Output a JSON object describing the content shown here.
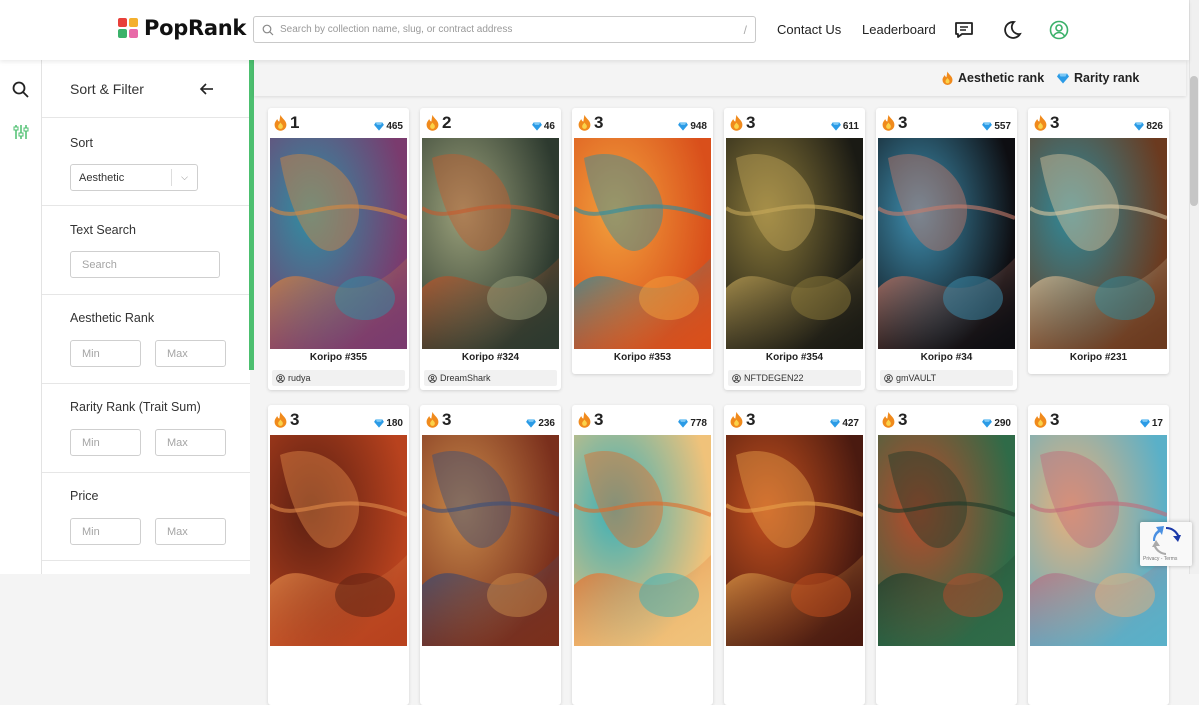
{
  "header": {
    "brand": "PopRank",
    "search_placeholder": "Search by collection name, slug, or contract address",
    "search_hint": "/",
    "contact_label": "Contact Us",
    "leaderboard_label": "Leaderboard",
    "icons": [
      "chat-icon",
      "moon-icon",
      "user-icon"
    ]
  },
  "rail": {
    "icons": [
      "search-icon",
      "sliders-icon"
    ]
  },
  "filters": {
    "title": "Sort & Filter",
    "sort_label": "Sort",
    "sort_value": "Aesthetic",
    "text_search_label": "Text Search",
    "text_search_placeholder": "Search",
    "aesthetic_label": "Aesthetic Rank",
    "rarity_label": "Rarity Rank (Trait Sum)",
    "price_label": "Price",
    "min_placeholder": "Min",
    "max_placeholder": "Max"
  },
  "legend": {
    "aesthetic": "Aesthetic rank",
    "rarity": "Rarity rank"
  },
  "colors": {
    "accent": "#4cbf6f",
    "fire": "#f08a1c",
    "diamond": "#2b9be6"
  },
  "cards": [
    {
      "rank": "1",
      "rarity": "465",
      "name": "Koripo #355",
      "owner": "rudya",
      "colors": [
        "#7a3b6e",
        "#2f8fa3",
        "#d8893f"
      ]
    },
    {
      "rank": "2",
      "rarity": "46",
      "name": "Koripo #324",
      "owner": "DreamShark",
      "colors": [
        "#2d3a2f",
        "#9aa07a",
        "#c65a2d"
      ]
    },
    {
      "rank": "3",
      "rarity": "948",
      "name": "Koripo #353",
      "owner": "",
      "colors": [
        "#d94f1b",
        "#f2a03c",
        "#2a8da3"
      ]
    },
    {
      "rank": "3",
      "rarity": "611",
      "name": "Koripo #354",
      "owner": "NFTDEGEN22",
      "colors": [
        "#1a1a14",
        "#8c7a3a",
        "#c6a85a"
      ]
    },
    {
      "rank": "3",
      "rarity": "557",
      "name": "Koripo #34",
      "owner": "gmVAULT",
      "colors": [
        "#0e0e12",
        "#3e8fb0",
        "#c77b6a"
      ]
    },
    {
      "rank": "3",
      "rarity": "826",
      "name": "Koripo #231",
      "owner": "",
      "colors": [
        "#6b3a1f",
        "#2f8a9a",
        "#d9c6a0"
      ]
    },
    {
      "rank": "3",
      "rarity": "180",
      "name": "",
      "owner": "",
      "colors": [
        "#b8421e",
        "#5a1f12",
        "#e08a4a"
      ]
    },
    {
      "rank": "3",
      "rarity": "236",
      "name": "",
      "owner": "",
      "colors": [
        "#7a2f1c",
        "#c8894a",
        "#3a4f7a"
      ]
    },
    {
      "rank": "3",
      "rarity": "778",
      "name": "",
      "owner": "",
      "colors": [
        "#f0c27a",
        "#3bb0b8",
        "#e06a2a"
      ]
    },
    {
      "rank": "3",
      "rarity": "427",
      "name": "",
      "owner": "",
      "colors": [
        "#4a1a10",
        "#c4501e",
        "#e8a04a"
      ]
    },
    {
      "rank": "3",
      "rarity": "290",
      "name": "",
      "owner": "",
      "colors": [
        "#2f6b48",
        "#b84a2a",
        "#1e3a2a"
      ]
    },
    {
      "rank": "3",
      "rarity": "17",
      "name": "",
      "owner": "",
      "colors": [
        "#5ab0c8",
        "#e8b07a",
        "#c26a7a"
      ]
    }
  ],
  "recaptcha": {
    "text": "Privacy - Terms"
  }
}
